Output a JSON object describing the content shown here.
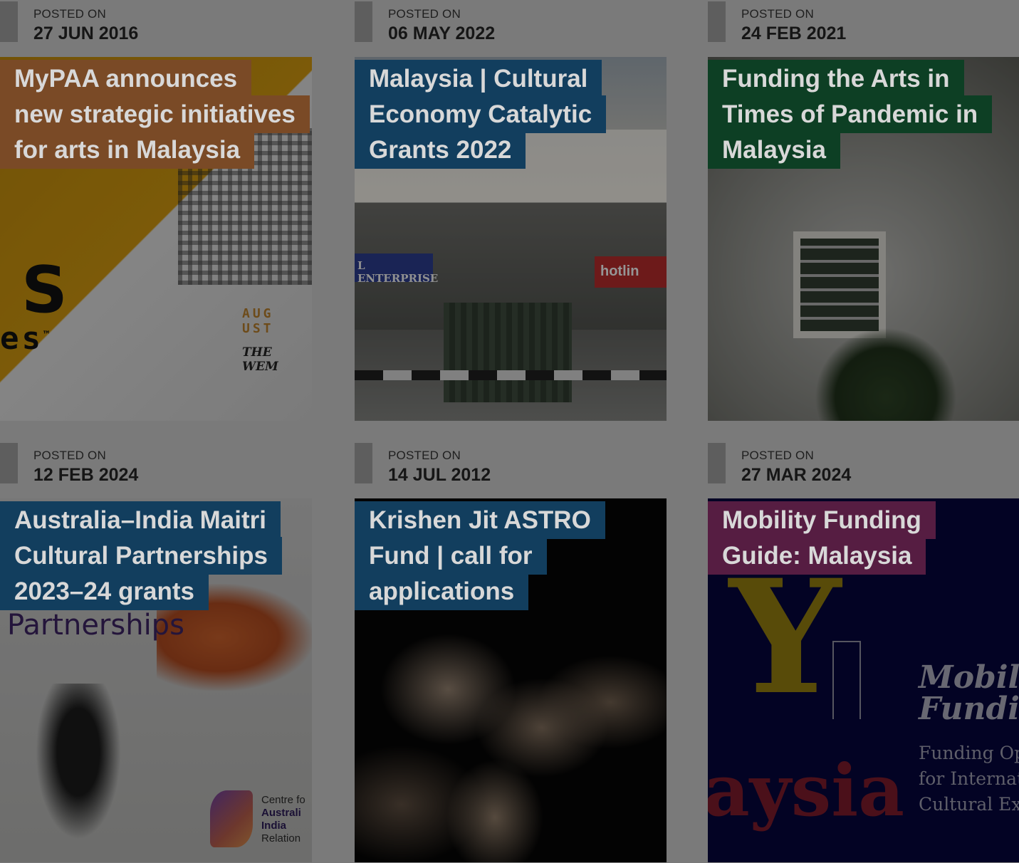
{
  "posted_label": "POSTED ON",
  "posts": [
    {
      "date": "27 JUN 2016",
      "title_lines": [
        "MyPAA announces",
        "new strategic initiatives",
        "for arts in Malaysia"
      ],
      "tag_color": "#7a4a26",
      "image": {
        "big_letter": "S",
        "suffix": "es",
        "tm": "™",
        "aug_text": "AUG\nUST",
        "wem_text": "THE WEM"
      }
    },
    {
      "date": "06 MAY 2022",
      "title_lines": [
        "Malaysia | Cultural",
        "Economy Catalytic",
        "Grants 2022"
      ],
      "tag_color": "#123e5e",
      "image": {
        "sign_left": "L ENTERPRISE",
        "sign_right": "hotlin"
      }
    },
    {
      "date": "24 FEB 2021",
      "title_lines": [
        "Funding the Arts in",
        "Times of Pandemic in",
        "Malaysia"
      ],
      "tag_color": "#0d3f24",
      "image": {}
    },
    {
      "date": "12 FEB 2024",
      "title_lines": [
        "Australia–India Maitri",
        "Cultural Partnerships",
        "2023–24 grants"
      ],
      "tag_color": "#123e5e",
      "image": {
        "partnerships": "Partnerships",
        "centre_lines": [
          "Centre fo",
          "Australi",
          "India",
          "Relation"
        ]
      }
    },
    {
      "date": "14 JUL 2012",
      "title_lines": [
        "Krishen Jit ASTRO",
        "Fund | call for",
        "applications"
      ],
      "tag_color": "#123e5e",
      "image": {}
    },
    {
      "date": "27 MAR 2024",
      "title_lines": [
        "Mobility Funding",
        "Guide: Malaysia"
      ],
      "tag_color": "#561d42",
      "image": {
        "big_y": "Y",
        "aysia": "aysia",
        "mob_lines": [
          "Mobili",
          "Fundi"
        ],
        "fund_lines": [
          "Funding Op",
          "for Internat",
          "Cultural Ex"
        ]
      }
    }
  ]
}
